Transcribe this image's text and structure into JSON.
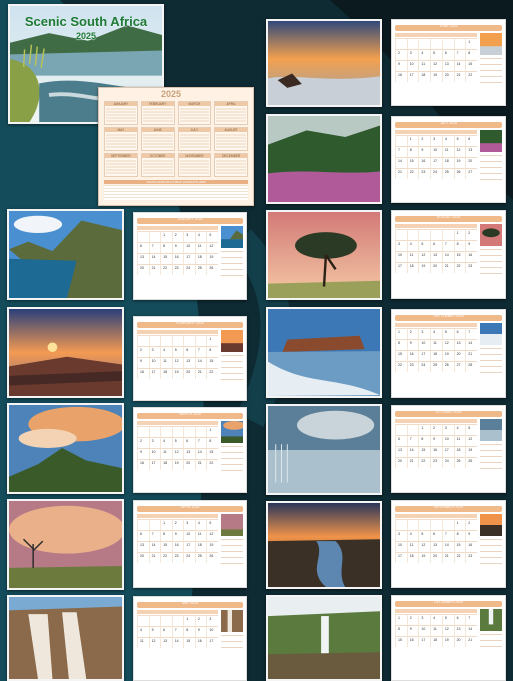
{
  "cover": {
    "title": "Scenic South Africa",
    "year": "2025"
  },
  "year_overview": {
    "year": "2025",
    "months": [
      "JANUARY",
      "FEBRUARY",
      "MARCH",
      "APRIL",
      "MAY",
      "JUNE",
      "JULY",
      "AUGUST",
      "SEPTEMBER",
      "OCTOBER",
      "NOVEMBER",
      "DECEMBER"
    ],
    "holidays_title": "SOUTH AFRICAN PUBLIC HOLIDAYS 2025"
  },
  "calendar_pages": [
    {
      "month": "JANUARY 2025"
    },
    {
      "month": "FEBRUARY 2025"
    },
    {
      "month": "MARCH 2025"
    },
    {
      "month": "APRIL 2025"
    },
    {
      "month": "MAY 2025"
    },
    {
      "month": "JUNE 2025"
    },
    {
      "month": "JULY 2025"
    },
    {
      "month": "AUGUST 2025"
    },
    {
      "month": "SEPTEMBER 2025"
    },
    {
      "month": "OCTOBER 2025"
    },
    {
      "month": "NOVEMBER 2025"
    },
    {
      "month": "DECEMBER 2025"
    }
  ],
  "colors": {
    "background_dark": "#0b1e24",
    "background_teal": "#124654",
    "accent_peach": "#f0b98a",
    "title_green": "#1e7a34"
  }
}
